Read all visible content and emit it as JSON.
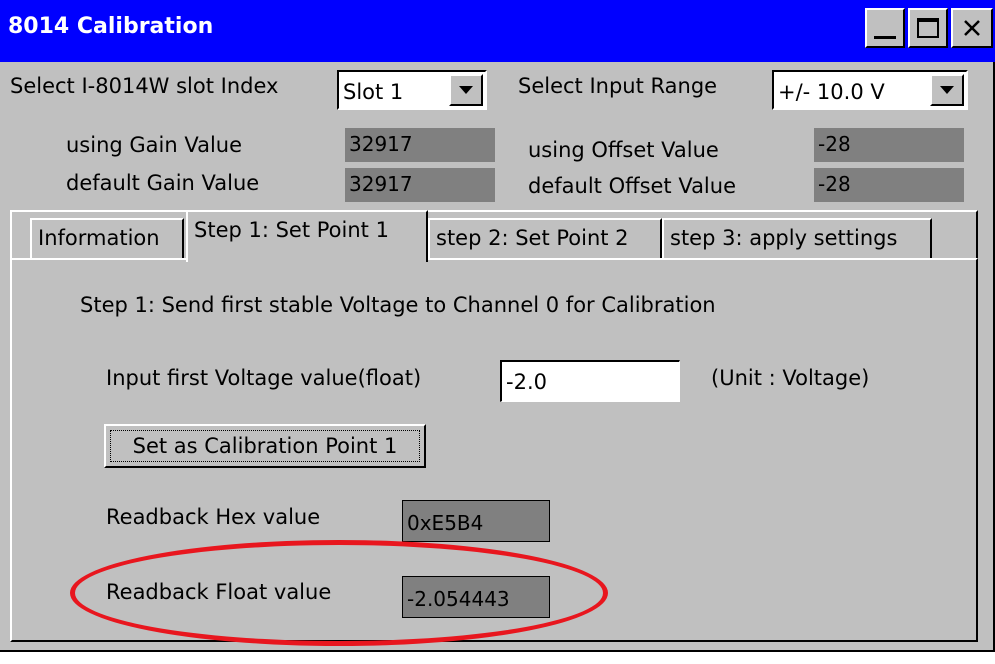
{
  "window": {
    "title": "8014 Calibration"
  },
  "top": {
    "slot_label": "Select I-8014W slot Index",
    "slot_value": "Slot 1",
    "range_label": "Select Input Range",
    "range_value": "+/- 10.0 V",
    "using_gain_label": "using Gain Value",
    "using_gain_value": "32917",
    "default_gain_label": "default Gain Value",
    "default_gain_value": "32917",
    "using_offset_label": "using Offset Value",
    "using_offset_value": "-28",
    "default_offset_label": "default Offset Value",
    "default_offset_value": "-28"
  },
  "tabs": [
    {
      "label": "Information"
    },
    {
      "label": "Step 1: Set Point 1",
      "active": true
    },
    {
      "label": "step 2: Set Point 2"
    },
    {
      "label": "step 3: apply settings"
    }
  ],
  "step1": {
    "instruction": "Step 1: Send first stable Voltage to Channel 0 for Calibration",
    "input_label": "Input first Voltage value(float)",
    "input_value": "-2.0",
    "unit_label": "(Unit : Voltage)",
    "set_button": "Set as Calibration Point 1",
    "hex_label": "Readback Hex value",
    "hex_value": "0xE5B4",
    "float_label": "Readback Float value",
    "float_value": "-2.054443"
  },
  "colors": {
    "titlebar": "#0000ff",
    "window_bg": "#c0c0c0",
    "readonly_bg": "#808080",
    "highlight_ellipse": "#e8161e"
  }
}
